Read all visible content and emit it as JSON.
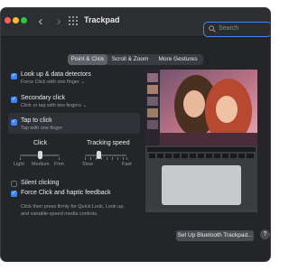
{
  "window": {
    "title": "Trackpad"
  },
  "search": {
    "placeholder": "Search"
  },
  "tabs": [
    {
      "label": "Point & Click",
      "active": true
    },
    {
      "label": "Scroll & Zoom",
      "active": false
    },
    {
      "label": "More Gestures",
      "active": false
    }
  ],
  "options": [
    {
      "title": "Look up & data detectors",
      "sub": "Force Click with one finger ⌄",
      "checked": true
    },
    {
      "title": "Secondary click",
      "sub": "Click or tap with two fingers ⌄",
      "checked": true
    },
    {
      "title": "Tap to click",
      "sub": "Tap with one finger",
      "checked": true
    }
  ],
  "sliders": {
    "click": {
      "title": "Click",
      "labels": [
        "Light",
        "Medium",
        "Firm"
      ],
      "level": 0.5
    },
    "tracking": {
      "title": "Tracking speed",
      "labels": [
        "Slow",
        "Fast"
      ],
      "level": 0.33
    }
  },
  "bottom_options": [
    {
      "title": "Silent clicking",
      "checked": false
    },
    {
      "title": "Force Click and haptic feedback",
      "checked": true
    }
  ],
  "force_click_description": "Click then press firmly for Quick Look, Look up, and variable-speed media controls.",
  "buttons": {
    "bluetooth": "Set Up Bluetooth Trackpad...",
    "help": "?"
  },
  "colors": {
    "accent": "#3d84f6",
    "window_bg": "#232529",
    "search_border": "#3f86f7"
  }
}
